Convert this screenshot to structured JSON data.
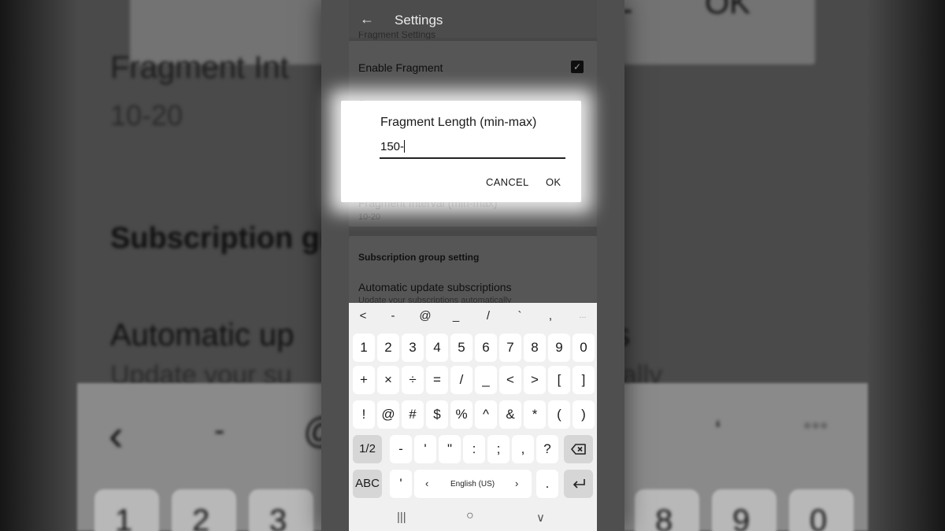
{
  "app": {
    "title": "Settings",
    "section_fragment_header_cut": "Fragment Settings",
    "enable_fragment_label": "Enable Fragment",
    "enable_fragment_checked": true,
    "row_fragment_packets_cut": "F",
    "row_fragment_packets_sub_cut": "tl",
    "row_fragment_length_cut": "F",
    "row_fragment_length_sub_cut": "5",
    "fragment_interval_label": "Fragment Interval (min-max)",
    "fragment_interval_value": "10-20",
    "subscription_header": "Subscription group setting",
    "auto_update_label": "Automatic update subscriptions",
    "auto_update_sub": "Update your subscriptions automatically"
  },
  "dialog": {
    "title": "Fragment Length (min-max)",
    "input_value": "150-",
    "cancel_label": "CANCEL",
    "ok_label": "OK"
  },
  "keyboard": {
    "symbol_bar": [
      "<",
      "-",
      "@",
      "_",
      "/",
      "`",
      ",",
      "..."
    ],
    "row1": [
      "1",
      "2",
      "3",
      "4",
      "5",
      "6",
      "7",
      "8",
      "9",
      "0"
    ],
    "row2": [
      "+",
      "×",
      "÷",
      "=",
      "/",
      "_",
      "<",
      ">",
      "[",
      "]"
    ],
    "row3": [
      "!",
      "@",
      "#",
      "$",
      "%",
      "^",
      "&",
      "*",
      "(",
      ")"
    ],
    "row4_page": "1/2",
    "row4": [
      "-",
      "'",
      "\"",
      ":",
      ";",
      ",",
      "?"
    ],
    "abc_label": "ABC",
    "apostrophe": "'",
    "language": "English (US)",
    "period": ".",
    "nav": [
      "|||",
      "○",
      "∨"
    ]
  },
  "background": {
    "big_interval_label": "Fragment Int",
    "big_interval_value": "10-20",
    "big_subscription": "Subscription gr",
    "big_auto_update": "Automatic up",
    "big_auto_update_sub": "Update your su",
    "big_s": "s",
    "big_ally": "ally",
    "big_ok": "OK",
    "big_dash": "-",
    "big_keys_left": [
      "1",
      "2",
      "3"
    ],
    "big_keys_right": [
      "8",
      "9",
      "0"
    ]
  }
}
